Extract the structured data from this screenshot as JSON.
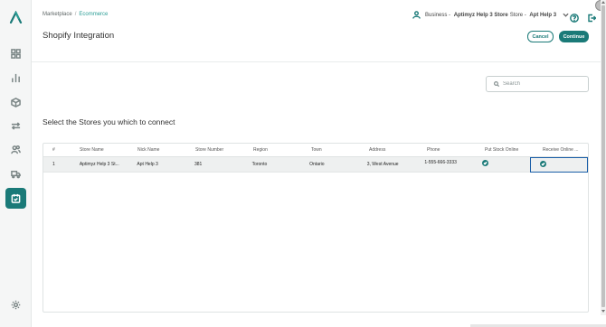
{
  "breadcrumb": {
    "parent": "Marketplace",
    "separator": "/",
    "current": "Ecommerce"
  },
  "page_title": "Shopify Integration",
  "business": {
    "prefix": "Business -",
    "name_bold": "Aptimyz Help 3 Store",
    "store_label": "Store -",
    "store_bold": "Apt Help 3"
  },
  "buttons": {
    "cancel": "Cancel",
    "continue": "Continue"
  },
  "search": {
    "placeholder": "Search",
    "value": ""
  },
  "section_title": "Select the Stores you which to connect",
  "table": {
    "headers": [
      "#",
      "Store Name",
      "Nick Name",
      "Store Number",
      "Region",
      "Town",
      "Address",
      "Phone",
      "Put Stock Online",
      "Receive Online ..."
    ],
    "rows": [
      {
        "num": "1",
        "store_name": "Aptimyz Help 3 St...",
        "nick_name": "Apt Help 3",
        "store_number": "381",
        "region": "Toronto",
        "town": "Ontario",
        "address": "3, West Avenue",
        "phone": "1-555-666-3333",
        "put_stock_online": true,
        "receive_online": true
      }
    ]
  },
  "icons": {
    "sidebar": [
      "dashboard-icon",
      "chart-icon",
      "box-icon",
      "transfer-icon",
      "users-icon",
      "truck-icon",
      "store-icon",
      "settings-icon"
    ],
    "header": [
      "user-icon",
      "chevron-down-icon",
      "help-icon",
      "logout-icon"
    ]
  },
  "colors": {
    "accent": "#1a7a78",
    "breadcrumb_active": "#2a9d95",
    "focus_border": "#1a5ea8"
  }
}
